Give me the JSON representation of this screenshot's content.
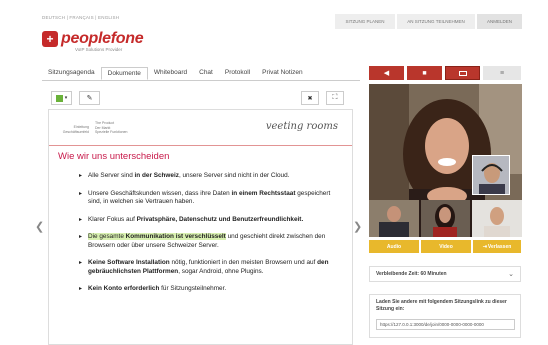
{
  "header": {
    "languages": "DEUTSCH | FRANÇAIS | ENGLISH",
    "nav": [
      "SITZUNG PLANEN",
      "AN SITZUNG TEILNEHMEN",
      "ANMELDEN"
    ],
    "logo_glyph": "+",
    "logo_text": "peoplefone",
    "logo_sub": "VoIP Solutions Provider"
  },
  "tabs": [
    "Sitzungsagenda",
    "Dokumente",
    "Whiteboard",
    "Chat",
    "Protokoll",
    "Privat Notizen"
  ],
  "active_tab": "Dokumente",
  "toolbar": {
    "close_glyph": "✖",
    "expand_glyph": "⛶"
  },
  "slide": {
    "hdr_left": "Einleitung\nGeschäftsumfeld",
    "hdr_mid": "The Product\nDer Markt\nSpezielle Funktionen",
    "brand": "veeting rooms",
    "title": "Wie wir uns unterscheiden",
    "bullets": [
      {
        "parts": [
          [
            "Alle Server sind ",
            ""
          ],
          [
            "in der Schweiz",
            "b"
          ],
          [
            ", unsere Server sind nicht in der Cloud.",
            ""
          ]
        ]
      },
      {
        "parts": [
          [
            "Unsere Geschäftskunden wissen, dass ihre Daten ",
            ""
          ],
          [
            "in einem Rechtsstaat",
            "b"
          ],
          [
            " gespeichert sind, in welchen sie Vertrauen haben.",
            ""
          ]
        ]
      },
      {
        "parts": [
          [
            "Klarer Fokus auf ",
            ""
          ],
          [
            "Privatsphäre, Datenschutz und Benutzerfreundlichkeit.",
            "b"
          ]
        ]
      },
      {
        "parts": [
          [
            "Die gesamte ",
            "h"
          ],
          [
            "Kommunikation ist verschlüsselt",
            "hb"
          ],
          [
            " und geschieht direkt zwischen den Browsern oder über unsere Schweizer Server.",
            ""
          ]
        ]
      },
      {
        "parts": [
          [
            "Keine Software Installation",
            "b"
          ],
          [
            " nötig, funktioniert in den meisten Browsern und auf ",
            ""
          ],
          [
            "den gebräuchlichsten Plattformen",
            "b"
          ],
          [
            ", sogar Android, ohne Plugins.",
            ""
          ]
        ]
      },
      {
        "parts": [
          [
            "Kein Konto erforderlich",
            "b"
          ],
          [
            " für Sitzungsteilnehmer.",
            ""
          ]
        ]
      }
    ]
  },
  "nav_arrows": {
    "left": "❮",
    "right": "❯"
  },
  "controls": {
    "colors": {
      "red": "#b9362c",
      "red_active": "#b9362c",
      "grey": "#e6e6e6"
    }
  },
  "video_buttons": {
    "audio": "Audio",
    "video": "Video",
    "leave": "Verlassen"
  },
  "remaining": {
    "label": "Verbleibende Zeit: 60 Minuten",
    "chevron": "⌄"
  },
  "invite": {
    "text": "Laden Sie andere mit folgendem Sitzungslink zu dieser Sitzung ein:",
    "link": "https://127.0.0.1:3000/de/join/0000-0000-0000-0000"
  }
}
